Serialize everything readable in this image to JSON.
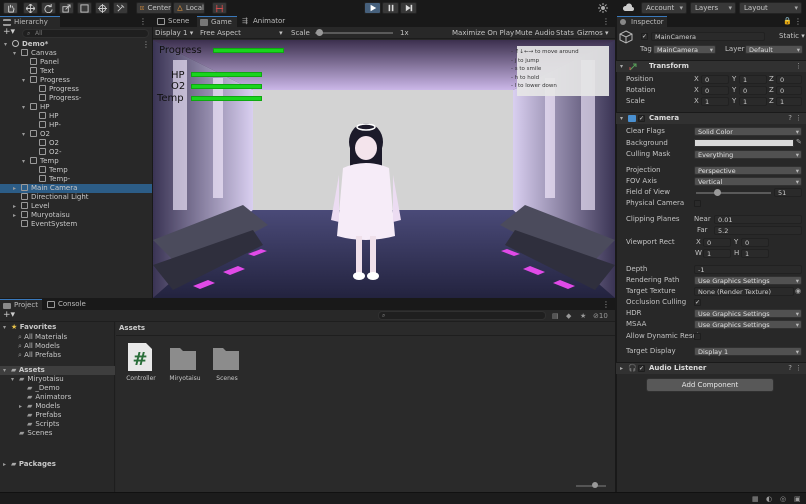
{
  "toolbar": {
    "pivot": "Center",
    "space": "Local",
    "account": "Account",
    "layers": "Layers",
    "layout": "Layout"
  },
  "hierarchy": {
    "tab": "Hierarchy",
    "search_placeholder": "All",
    "items": [
      {
        "label": "Demo*",
        "depth": 0,
        "arrow": "▾",
        "icon": "scene-icon"
      },
      {
        "label": "Canvas",
        "depth": 1,
        "arrow": "▾",
        "icon": "cube"
      },
      {
        "label": "Panel",
        "depth": 2,
        "arrow": "",
        "icon": "cube"
      },
      {
        "label": "Text",
        "depth": 2,
        "arrow": "",
        "icon": "cube"
      },
      {
        "label": "Progress",
        "depth": 2,
        "arrow": "▾",
        "icon": "cube"
      },
      {
        "label": "Progress",
        "depth": 3,
        "arrow": "",
        "icon": "cube"
      },
      {
        "label": "Progress-",
        "depth": 3,
        "arrow": "",
        "icon": "cube"
      },
      {
        "label": "HP",
        "depth": 2,
        "arrow": "▾",
        "icon": "cube"
      },
      {
        "label": "HP",
        "depth": 3,
        "arrow": "",
        "icon": "cube"
      },
      {
        "label": "HP-",
        "depth": 3,
        "arrow": "",
        "icon": "cube"
      },
      {
        "label": "O2",
        "depth": 2,
        "arrow": "▾",
        "icon": "cube"
      },
      {
        "label": "O2",
        "depth": 3,
        "arrow": "",
        "icon": "cube"
      },
      {
        "label": "O2-",
        "depth": 3,
        "arrow": "",
        "icon": "cube"
      },
      {
        "label": "Temp",
        "depth": 2,
        "arrow": "▾",
        "icon": "cube"
      },
      {
        "label": "Temp",
        "depth": 3,
        "arrow": "",
        "icon": "cube"
      },
      {
        "label": "Temp-",
        "depth": 3,
        "arrow": "",
        "icon": "cube"
      },
      {
        "label": "Main Camera",
        "depth": 1,
        "arrow": "▸",
        "icon": "cube",
        "selected": true
      },
      {
        "label": "Directional Light",
        "depth": 1,
        "arrow": "",
        "icon": "cube"
      },
      {
        "label": "Level",
        "depth": 1,
        "arrow": "▸",
        "icon": "cube"
      },
      {
        "label": "Muryotaisu",
        "depth": 1,
        "arrow": "▸",
        "icon": "cube"
      },
      {
        "label": "EventSystem",
        "depth": 1,
        "arrow": "",
        "icon": "cube"
      }
    ]
  },
  "game": {
    "tabs": [
      "Scene",
      "Game",
      "Animator"
    ],
    "display": "Display 1",
    "aspect": "Free Aspect",
    "scale_label": "Scale",
    "scale_value": "1x",
    "options": [
      "Maximize On Play",
      "Mute Audio",
      "Stats",
      "Gizmos"
    ],
    "hud": {
      "progress": "Progress",
      "hp": "HP",
      "o2": "O2",
      "temp": "Temp",
      "progress_fill": 0.85,
      "hp_fill": 0.85,
      "o2_fill": 0.85,
      "temp_fill": 0.85
    },
    "help": [
      "- ↑↓←→ to move around",
      "- j to jump",
      "- s to smile",
      "- h to hold",
      "- l to lower down"
    ]
  },
  "project": {
    "tabs": [
      "Project",
      "Console"
    ],
    "hidden_count": "10",
    "favorites": {
      "title": "Favorites",
      "items": [
        "All Materials",
        "All Models",
        "All Prefabs"
      ]
    },
    "assets_tree": {
      "title": "Assets",
      "items": [
        {
          "label": "Miryotaisu",
          "depth": 1,
          "arrow": "▾"
        },
        {
          "label": "_Demo",
          "depth": 2,
          "arrow": ""
        },
        {
          "label": "Animators",
          "depth": 2,
          "arrow": ""
        },
        {
          "label": "Models",
          "depth": 2,
          "arrow": "▸"
        },
        {
          "label": "Prefabs",
          "depth": 2,
          "arrow": ""
        },
        {
          "label": "Scripts",
          "depth": 2,
          "arrow": ""
        },
        {
          "label": "Scenes",
          "depth": 1,
          "arrow": ""
        }
      ]
    },
    "packages": "Packages",
    "breadcrumb": "Assets",
    "grid": [
      {
        "label": "Controller",
        "type": "script"
      },
      {
        "label": "Miryotaisu",
        "type": "folder"
      },
      {
        "label": "Scenes",
        "type": "folder"
      }
    ]
  },
  "inspector": {
    "tab": "Inspector",
    "object_name": "MainCamera",
    "static_label": "Static",
    "tag_label": "Tag",
    "tag_value": "MainCamera",
    "layer_label": "Layer",
    "layer_value": "Default",
    "transform": {
      "title": "Transform",
      "rows": [
        {
          "label": "Position",
          "x": "0",
          "y": "1",
          "z": "0"
        },
        {
          "label": "Rotation",
          "x": "0",
          "y": "0",
          "z": "0"
        },
        {
          "label": "Scale",
          "x": "1",
          "y": "1",
          "z": "1"
        }
      ]
    },
    "camera": {
      "title": "Camera",
      "clear_flags": {
        "label": "Clear Flags",
        "value": "Solid Color"
      },
      "background": {
        "label": "Background",
        "color": "#d9d9d9"
      },
      "culling_mask": {
        "label": "Culling Mask",
        "value": "Everything"
      },
      "projection": {
        "label": "Projection",
        "value": "Perspective"
      },
      "fov_axis": {
        "label": "FOV Axis",
        "value": "Vertical"
      },
      "fov": {
        "label": "Field of View",
        "value": "51",
        "fraction": 0.28
      },
      "physical": {
        "label": "Physical Camera"
      },
      "clipping": {
        "label": "Clipping Planes",
        "near_label": "Near",
        "near": "0.01",
        "far_label": "Far",
        "far": "5.2"
      },
      "viewport": {
        "label": "Viewport Rect",
        "x": "0",
        "y": "0",
        "w": "1",
        "h": "1"
      },
      "depth": {
        "label": "Depth",
        "value": "-1"
      },
      "rendering_path": {
        "label": "Rendering Path",
        "value": "Use Graphics Settings"
      },
      "target_texture": {
        "label": "Target Texture",
        "value": "None (Render Texture)"
      },
      "occlusion": {
        "label": "Occlusion Culling"
      },
      "hdr": {
        "label": "HDR",
        "value": "Use Graphics Settings"
      },
      "msaa": {
        "label": "MSAA",
        "value": "Use Graphics Settings"
      },
      "dynamic_res": {
        "label": "Allow Dynamic Resol"
      },
      "target_display": {
        "label": "Target Display",
        "value": "Display 1"
      }
    },
    "audio_listener": "Audio Listener",
    "add_component": "Add Component"
  },
  "colors": {
    "accent": "#3a79bb",
    "selection": "#2c5d87",
    "hud_bar": "#19d51d"
  }
}
